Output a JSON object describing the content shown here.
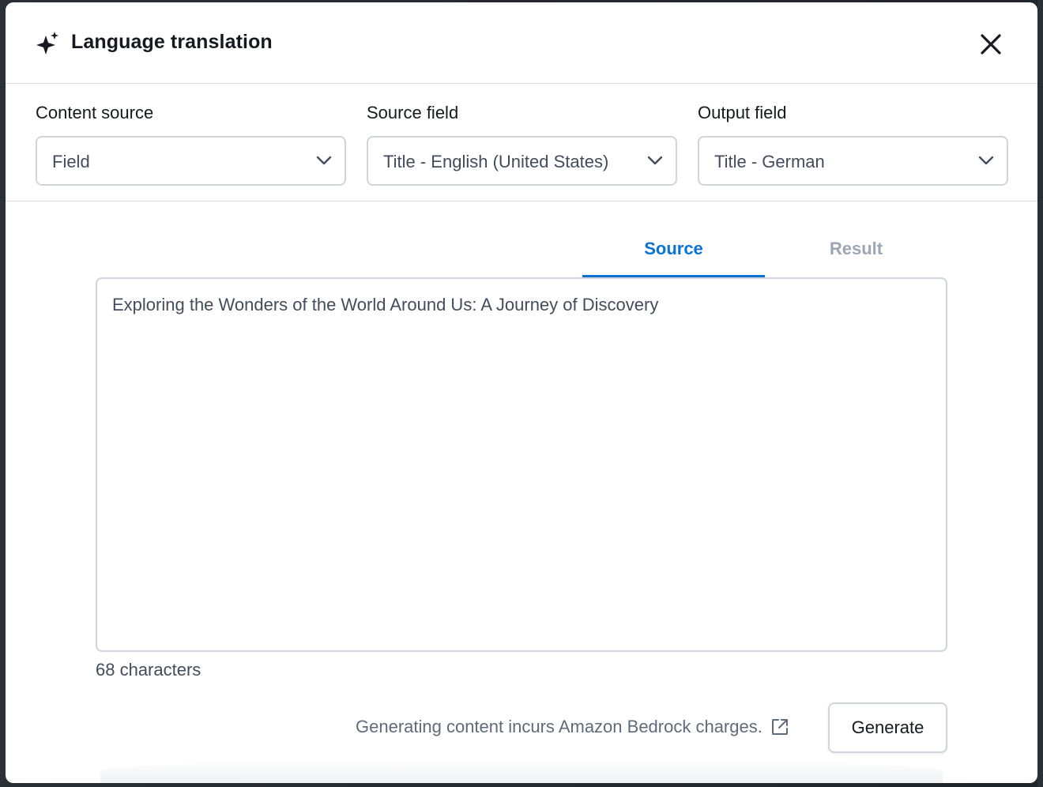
{
  "modal": {
    "title": "Language translation",
    "icons": {
      "title_icon": "sparkle-icon",
      "close": "close-icon"
    }
  },
  "fields": {
    "content_source": {
      "label": "Content source",
      "value": "Field"
    },
    "source_field": {
      "label": "Source field",
      "value": "Title - English (United States)"
    },
    "output_field": {
      "label": "Output field",
      "value": "Title - German"
    }
  },
  "tabs": [
    {
      "label": "Source",
      "active": true
    },
    {
      "label": "Result",
      "active": false
    }
  ],
  "editor": {
    "text": "Exploring the Wonders of the World Around Us: A Journey of Discovery",
    "char_count": "68 characters"
  },
  "footer": {
    "note": "Generating content incurs Amazon Bedrock charges.",
    "note_icon": "external-link-icon",
    "generate_label": "Generate"
  },
  "colors": {
    "accent": "#0972d3",
    "text": "#16191f",
    "muted": "#9ba7b6"
  }
}
